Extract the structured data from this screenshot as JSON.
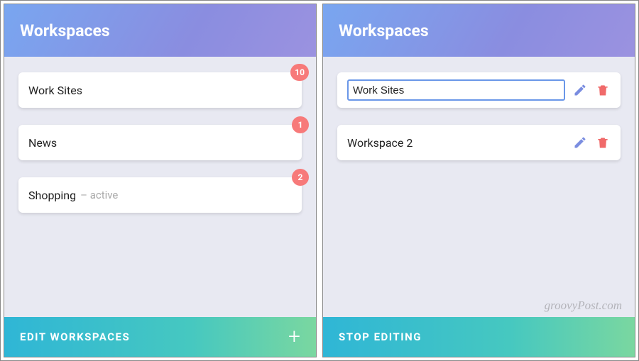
{
  "left": {
    "title": "Workspaces",
    "items": [
      {
        "label": "Work Sites",
        "badge": "10"
      },
      {
        "label": "News",
        "badge": "1"
      },
      {
        "label": "Shopping",
        "sub": "– active",
        "badge": "2"
      }
    ],
    "footer": {
      "label": "EDIT WORKSPACES",
      "plus": "+"
    }
  },
  "right": {
    "title": "Workspaces",
    "items": [
      {
        "label": "Work Sites",
        "editing": true
      },
      {
        "label": "Workspace 2",
        "editing": false
      }
    ],
    "footer": {
      "label": "STOP EDITING"
    }
  },
  "colors": {
    "badge": "#f77a7a",
    "pencil": "#7a8de0",
    "trash": "#f06a6a"
  },
  "watermark": "groovyPost.com"
}
